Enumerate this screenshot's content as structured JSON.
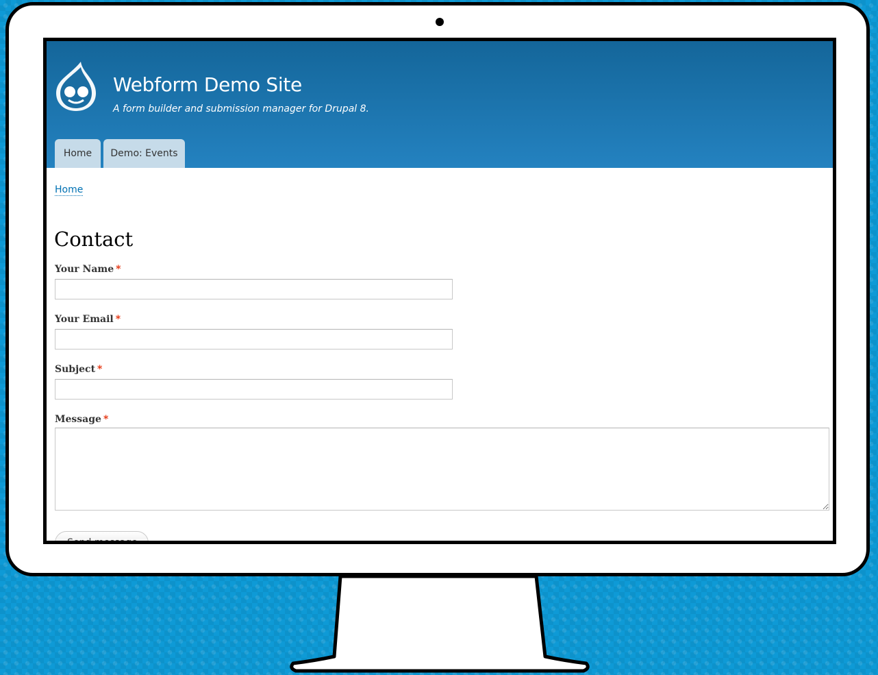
{
  "site": {
    "name": "Webform Demo Site",
    "slogan": "A form builder and submission manager for Drupal 8.",
    "logo_icon": "drupal-drop-logo-icon"
  },
  "tabs": [
    {
      "label": "Home"
    },
    {
      "label": "Demo: Events"
    }
  ],
  "breadcrumb": {
    "home": "Home"
  },
  "page": {
    "title": "Contact"
  },
  "form": {
    "required_marker": "*",
    "name": {
      "label": "Your Name",
      "value": ""
    },
    "email": {
      "label": "Your Email",
      "value": ""
    },
    "subject": {
      "label": "Subject",
      "value": ""
    },
    "message": {
      "label": "Message",
      "value": ""
    },
    "submit_label": "Send message"
  },
  "colors": {
    "header_top": "#14669a",
    "header_bottom": "#2482c0",
    "tab_bg": "#c6dbe9",
    "link": "#0071b3",
    "required": "#e32700",
    "background": "#0e9ad6"
  }
}
